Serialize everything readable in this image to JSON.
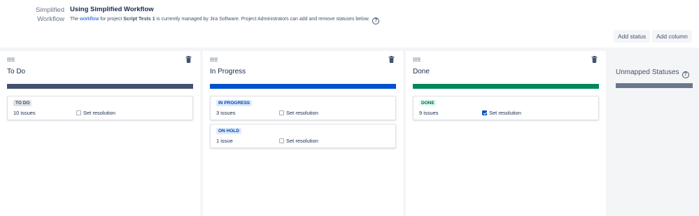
{
  "header": {
    "label_line1": "Simplified",
    "label_line2": "Workflow",
    "title": "Using Simplified Workflow",
    "desc_prefix": "The ",
    "desc_link": "workflow",
    "desc_mid": " for project ",
    "desc_project": "Script Tests 1",
    "desc_suffix": " is currently managed by Jira Software. Project Administrators can add and remove statuses below.",
    "help_icon": "question-circle-icon"
  },
  "toolbar": {
    "add_status": "Add status",
    "add_column": "Add column"
  },
  "columns": [
    {
      "title": "To Do",
      "bar_color": "#42526e",
      "cards": [
        {
          "status": "TO DO",
          "status_bg": "#dfe1e6",
          "status_fg": "#42526e",
          "count": "10 issues",
          "resolution": "Set resolution",
          "checked": false
        }
      ]
    },
    {
      "title": "In Progress",
      "bar_color": "#0052cc",
      "cards": [
        {
          "status": "IN PROGRESS",
          "status_bg": "#deebff",
          "status_fg": "#0747a6",
          "count": "3 issues",
          "resolution": "Set resolution",
          "checked": false
        },
        {
          "status": "ON HOLD",
          "status_bg": "#deebff",
          "status_fg": "#0747a6",
          "count": "1 issue",
          "resolution": "Set resolution",
          "checked": false
        }
      ]
    },
    {
      "title": "Done",
      "bar_color": "#00875a",
      "cards": [
        {
          "status": "DONE",
          "status_bg": "#e3fcef",
          "status_fg": "#006644",
          "count": "9 issues",
          "resolution": "Set resolution",
          "checked": true
        }
      ]
    }
  ],
  "unmapped": {
    "title": "Unmapped Statuses",
    "bar_color": "#6b778c"
  }
}
